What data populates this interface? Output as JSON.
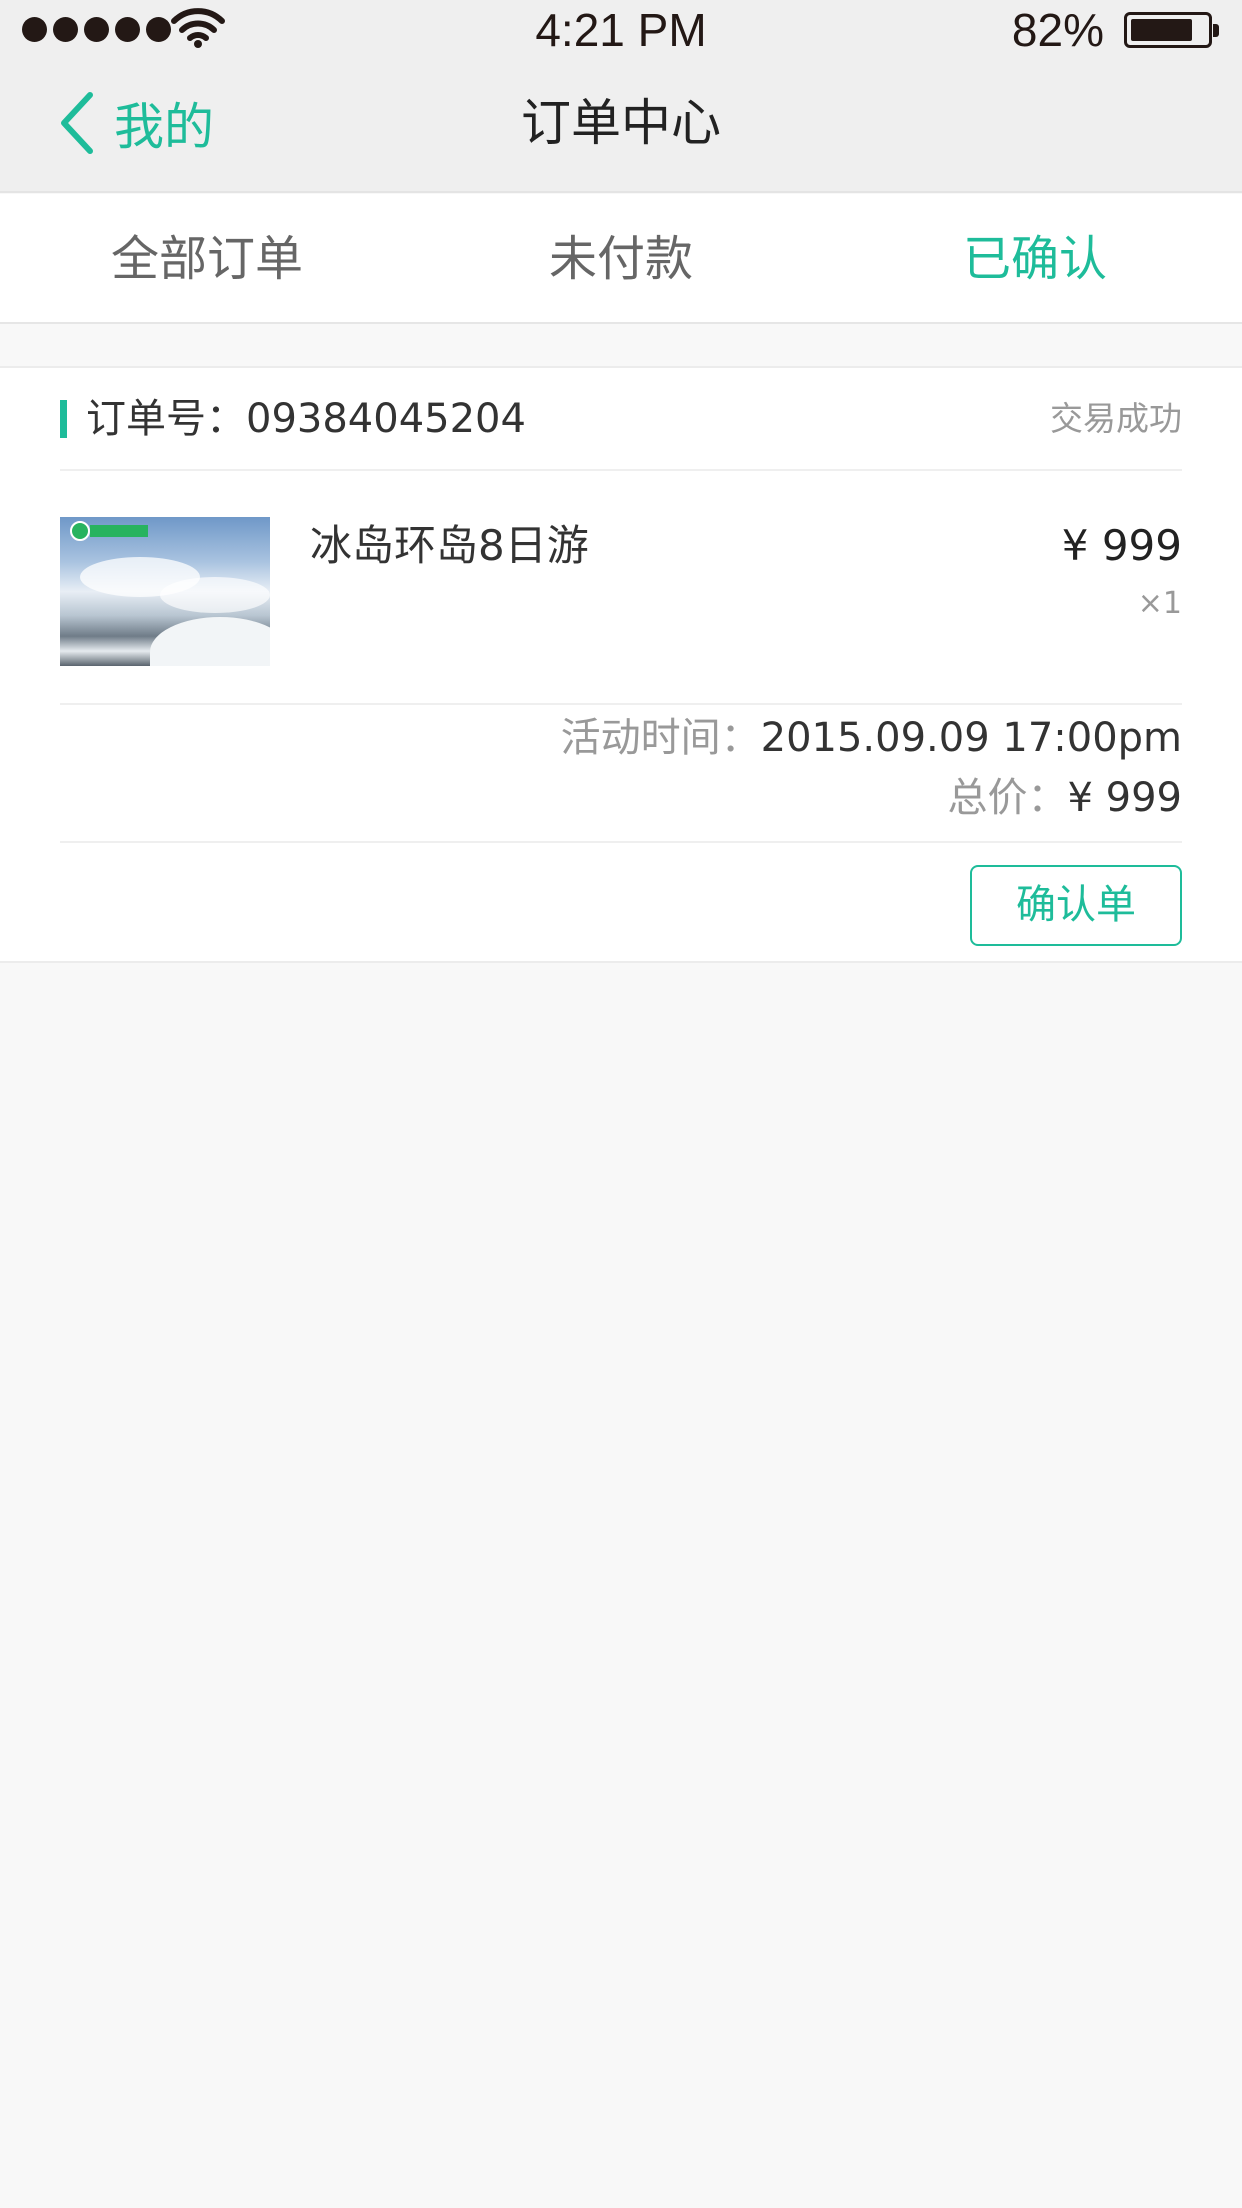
{
  "status_bar": {
    "time": "4:21 PM",
    "battery": "82%",
    "battery_level": 0.82
  },
  "nav": {
    "back_label": "我的",
    "title": "订单中心"
  },
  "tabs": [
    {
      "label": "全部订单",
      "active": false
    },
    {
      "label": "未付款",
      "active": false
    },
    {
      "label": "已确认",
      "active": true
    }
  ],
  "order": {
    "number_label": "订单号：",
    "number": "09384045204",
    "status": "交易成功",
    "product_name": "冰岛环岛8日游",
    "price": "¥ 999",
    "quantity": "×1",
    "time_label": "活动时间：",
    "time_value": "2015.09.09  17:00pm",
    "total_label": "总价：",
    "total_value": "¥ 999",
    "confirm_button": "确认单"
  },
  "colors": {
    "accent": "#1ebc9a",
    "nav_bg": "#efefef",
    "page_bg": "#f8f8f8"
  }
}
